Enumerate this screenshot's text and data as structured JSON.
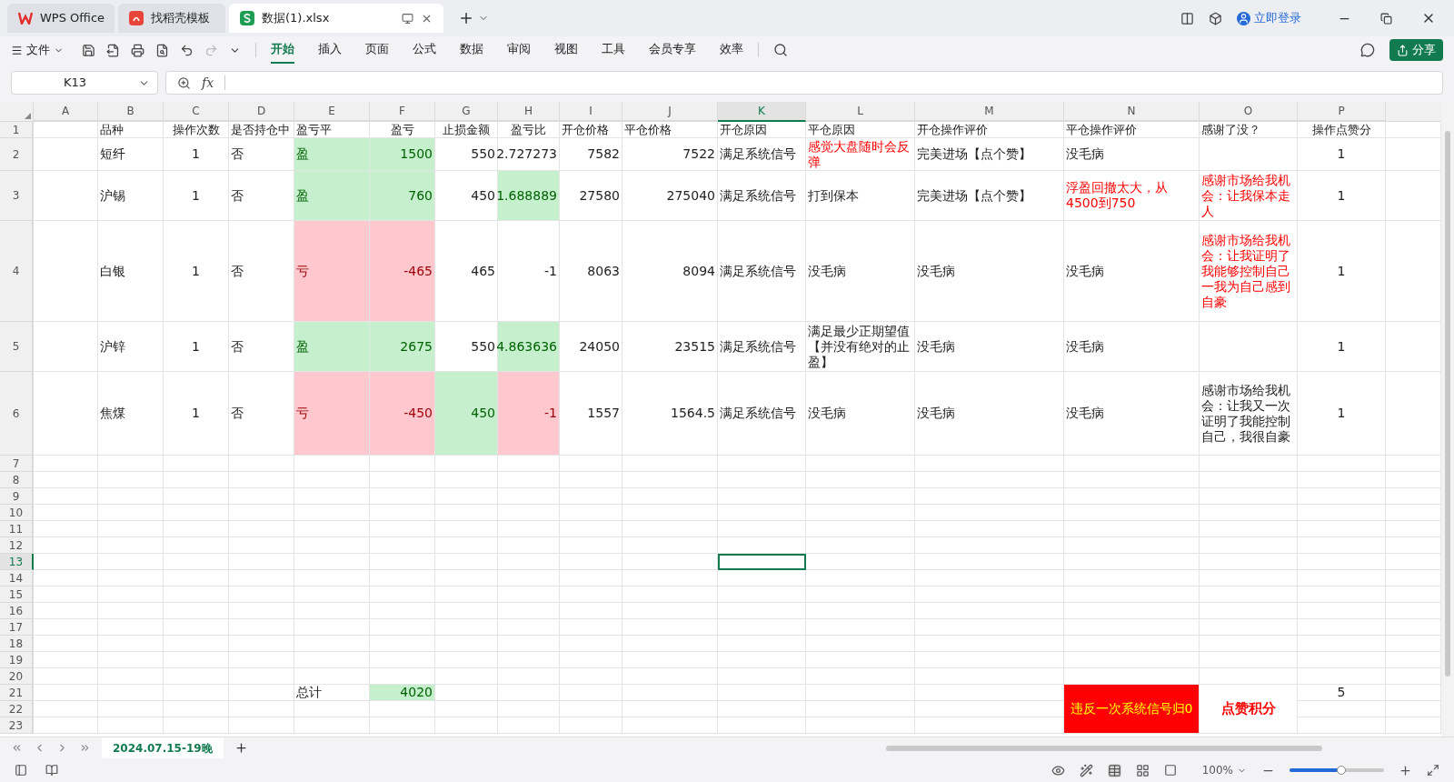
{
  "tabs": [
    {
      "label": "WPS Office",
      "kind": "home",
      "selected": false
    },
    {
      "label": "找稻壳模板",
      "kind": "template",
      "selected": false
    },
    {
      "label": "数据(1).xlsx",
      "kind": "sheet",
      "selected": true
    }
  ],
  "account": {
    "label": "立即登录"
  },
  "menu": {
    "file": "文件",
    "ribbon_tabs": [
      {
        "label": "开始",
        "selected": true
      },
      {
        "label": "插入",
        "selected": false
      },
      {
        "label": "页面",
        "selected": false
      },
      {
        "label": "公式",
        "selected": false
      },
      {
        "label": "数据",
        "selected": false
      },
      {
        "label": "审阅",
        "selected": false
      },
      {
        "label": "视图",
        "selected": false
      },
      {
        "label": "工具",
        "selected": false
      },
      {
        "label": "会员专享",
        "selected": false
      },
      {
        "label": "效率",
        "selected": false
      }
    ],
    "share": "分享"
  },
  "formula_bar": {
    "name_box": "K13",
    "fx": "fx"
  },
  "sheet": {
    "columns": [
      {
        "label": "A",
        "selected": false
      },
      {
        "label": "B",
        "selected": false
      },
      {
        "label": "C",
        "selected": false
      },
      {
        "label": "D",
        "selected": false
      },
      {
        "label": "E",
        "selected": false
      },
      {
        "label": "F",
        "selected": false
      },
      {
        "label": "G",
        "selected": false
      },
      {
        "label": "H",
        "selected": false
      },
      {
        "label": "I",
        "selected": false
      },
      {
        "label": "J",
        "selected": false
      },
      {
        "label": "K",
        "selected": true
      },
      {
        "label": "L",
        "selected": false
      },
      {
        "label": "M",
        "selected": false
      },
      {
        "label": "N",
        "selected": false
      },
      {
        "label": "O",
        "selected": false
      },
      {
        "label": "P",
        "selected": false
      }
    ],
    "rows": [
      {
        "label": "1",
        "selected": false,
        "cells": [
          {
            "text": ""
          },
          {
            "text": "品种"
          },
          {
            "text": "操作次数"
          },
          {
            "text": "是否持仓中"
          },
          {
            "text": "盈亏平"
          },
          {
            "text": "盈亏"
          },
          {
            "text": "止损金额"
          },
          {
            "text": "盈亏比"
          },
          {
            "text": "开仓价格"
          },
          {
            "text": "平仓价格"
          },
          {
            "text": "开仓原因"
          },
          {
            "text": "平仓原因"
          },
          {
            "text": "开仓操作评价"
          },
          {
            "text": "平仓操作评价"
          },
          {
            "text": "感谢了没？"
          },
          {
            "text": "操作点赞分"
          }
        ]
      },
      {
        "label": "2",
        "selected": false,
        "cells": [
          {
            "text": ""
          },
          {
            "text": "短纤"
          },
          {
            "text": "1"
          },
          {
            "text": "否"
          },
          {
            "text": "盈",
            "kind": "gain"
          },
          {
            "text": "1500",
            "kind": "gain"
          },
          {
            "text": "550"
          },
          {
            "text": "2.727273"
          },
          {
            "text": "7582"
          },
          {
            "text": "7522"
          },
          {
            "text": "满足系统信号"
          },
          {
            "text": "感觉大盘随时会反弹",
            "kind": "alert"
          },
          {
            "text": "完美进场【点个赞】"
          },
          {
            "text": "没毛病"
          },
          {
            "text": ""
          },
          {
            "text": "1"
          }
        ]
      },
      {
        "label": "3",
        "selected": false,
        "cells": [
          {
            "text": ""
          },
          {
            "text": "沪锡"
          },
          {
            "text": "1"
          },
          {
            "text": "否"
          },
          {
            "text": "盈",
            "kind": "gain"
          },
          {
            "text": "760",
            "kind": "gain"
          },
          {
            "text": "450"
          },
          {
            "text": "1.688889",
            "kind": "gain"
          },
          {
            "text": "27580"
          },
          {
            "text": "275040"
          },
          {
            "text": "满足系统信号"
          },
          {
            "text": "打到保本"
          },
          {
            "text": "完美进场【点个赞】"
          },
          {
            "text": "浮盈回撤太大，从4500到750",
            "kind": "alert"
          },
          {
            "text": "感谢市场给我机会：让我保本走人",
            "kind": "alert"
          },
          {
            "text": "1"
          }
        ]
      },
      {
        "label": "4",
        "selected": false,
        "cells": [
          {
            "text": ""
          },
          {
            "text": "白银"
          },
          {
            "text": "1"
          },
          {
            "text": "否"
          },
          {
            "text": "亏",
            "kind": "loss"
          },
          {
            "text": "-465",
            "kind": "loss"
          },
          {
            "text": "465"
          },
          {
            "text": "-1"
          },
          {
            "text": "8063"
          },
          {
            "text": "8094"
          },
          {
            "text": "满足系统信号"
          },
          {
            "text": "没毛病"
          },
          {
            "text": "没毛病"
          },
          {
            "text": "没毛病"
          },
          {
            "text": "感谢市场给我机会：让我证明了我能够控制自己一我为自己感到自豪",
            "kind": "alert"
          },
          {
            "text": "1"
          }
        ]
      },
      {
        "label": "5",
        "selected": false,
        "cells": [
          {
            "text": ""
          },
          {
            "text": "沪锌"
          },
          {
            "text": "1"
          },
          {
            "text": "否"
          },
          {
            "text": "盈",
            "kind": "gain"
          },
          {
            "text": "2675",
            "kind": "gain"
          },
          {
            "text": "550"
          },
          {
            "text": "4.863636",
            "kind": "gain"
          },
          {
            "text": "24050"
          },
          {
            "text": "23515"
          },
          {
            "text": "满足系统信号"
          },
          {
            "text": "满足最少正期望值【并没有绝对的止盈】"
          },
          {
            "text": "没毛病"
          },
          {
            "text": "没毛病"
          },
          {
            "text": ""
          },
          {
            "text": "1"
          }
        ]
      },
      {
        "label": "6",
        "selected": false,
        "cells": [
          {
            "text": ""
          },
          {
            "text": "焦煤"
          },
          {
            "text": "1"
          },
          {
            "text": "否"
          },
          {
            "text": "亏",
            "kind": "loss"
          },
          {
            "text": "-450",
            "kind": "loss"
          },
          {
            "text": "450",
            "kind": "gain"
          },
          {
            "text": "-1",
            "kind": "loss"
          },
          {
            "text": "1557"
          },
          {
            "text": "1564.5"
          },
          {
            "text": "满足系统信号"
          },
          {
            "text": "没毛病"
          },
          {
            "text": "没毛病"
          },
          {
            "text": "没毛病"
          },
          {
            "text": "感谢市场给我机会：让我又一次证明了我能控制自己，我很自豪"
          },
          {
            "text": "1"
          }
        ]
      },
      {
        "label": "7",
        "selected": false,
        "cells": []
      },
      {
        "label": "8",
        "selected": false,
        "cells": []
      },
      {
        "label": "9",
        "selected": false,
        "cells": []
      },
      {
        "label": "10",
        "selected": false,
        "cells": []
      },
      {
        "label": "11",
        "selected": false,
        "cells": []
      },
      {
        "label": "12",
        "selected": false,
        "cells": []
      },
      {
        "label": "13",
        "selected": true,
        "cells": []
      },
      {
        "label": "14",
        "selected": false,
        "cells": []
      },
      {
        "label": "15",
        "selected": false,
        "cells": []
      },
      {
        "label": "16",
        "selected": false,
        "cells": []
      },
      {
        "label": "17",
        "selected": false,
        "cells": []
      },
      {
        "label": "18",
        "selected": false,
        "cells": []
      },
      {
        "label": "19",
        "selected": false,
        "cells": []
      },
      {
        "label": "20",
        "selected": false,
        "cells": []
      },
      {
        "label": "21",
        "selected": false,
        "cells": [
          {
            "text": ""
          },
          {
            "text": ""
          },
          {
            "text": ""
          },
          {
            "text": ""
          },
          {
            "text": "总计"
          },
          {
            "text": "4020",
            "kind": "gain"
          },
          {
            "text": ""
          },
          {
            "text": ""
          },
          {
            "text": ""
          },
          {
            "text": ""
          },
          {
            "text": ""
          },
          {
            "text": ""
          },
          {
            "text": ""
          },
          {
            "text": "违反一次系统信号归0",
            "kind": "alert_fill",
            "merged": true
          },
          {
            "text": "点赞积分",
            "kind": "emphasis",
            "merged": true
          },
          {
            "text": "5"
          }
        ]
      },
      {
        "label": "22",
        "selected": false,
        "cells": []
      },
      {
        "label": "23",
        "selected": false,
        "cells": []
      }
    ]
  },
  "sheet_tabs": [
    {
      "label": "2024.07.15-19晚",
      "selected": true
    }
  ],
  "status_bar": {
    "zoom": {
      "label": "100%",
      "level": 0.55
    }
  }
}
